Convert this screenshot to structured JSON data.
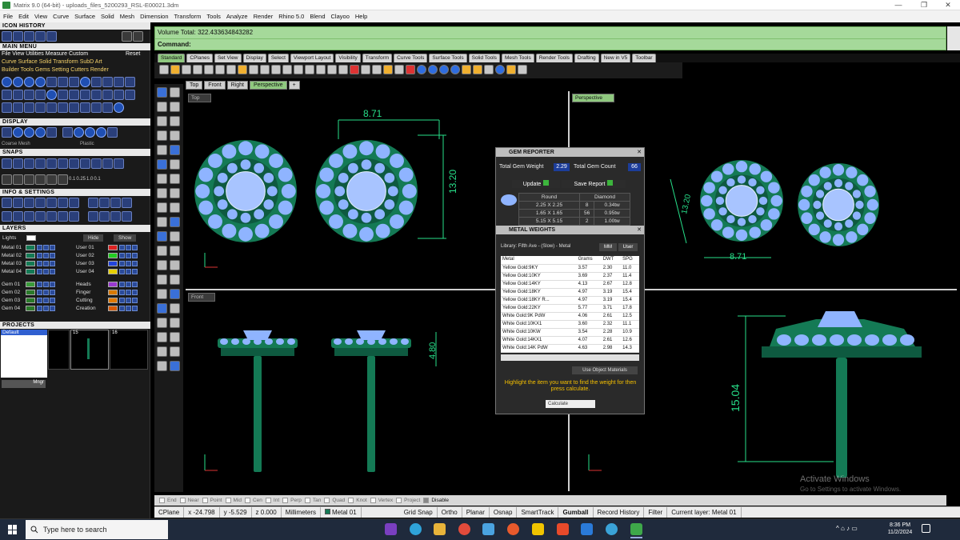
{
  "window": {
    "title": "Matrix 9.0 (64-bit) - uploads_files_5200293_RSL-E00021.3dm",
    "min": "—",
    "max": "❐",
    "close": "✕"
  },
  "menu": [
    "File",
    "Edit",
    "View",
    "Curve",
    "Surface",
    "Solid",
    "Mesh",
    "Dimension",
    "Transform",
    "Tools",
    "Analyze",
    "Render",
    "Rhino 5.0",
    "Blend",
    "Clayoo",
    "Help"
  ],
  "left": {
    "icon_history": "ICON HISTORY",
    "main_menu": "MAIN MENU",
    "main_menu_row1": [
      "File",
      "View",
      "Utilities",
      "Measure",
      "Custom"
    ],
    "main_menu_reset": "Reset",
    "main_menu_row2": [
      "Curve",
      "Surface",
      "Solid",
      "Transform",
      "SubD",
      "Art"
    ],
    "main_menu_row3": [
      "Builder",
      "Tools",
      "Gems",
      "Setting",
      "Cutters",
      "Render"
    ],
    "display": "DISPLAY",
    "display_modes": [
      "Coarse Mesh",
      "Plastic"
    ],
    "snaps": "SNAPS",
    "snap_values": [
      "0.1",
      "0.25",
      "1.0",
      "0.1"
    ],
    "info_settings": "INFO & SETTINGS",
    "layers": "LAYERS",
    "layers_lights": "Lights",
    "layers_hide": "Hide",
    "layers_show": "Show",
    "layer_col1": [
      "Metal 01",
      "Metal 02",
      "Metal 03",
      "Metal 04",
      "",
      "Gem 01",
      "Gem 02",
      "Gem 03",
      "Gem 04"
    ],
    "layer_col2": [
      "User 01",
      "User 02",
      "User 03",
      "User 04",
      "",
      "Heads",
      "Finger",
      "Cutting",
      "Creation"
    ],
    "projects": "PROJECTS",
    "project_default": "Default",
    "project_nums": [
      "15",
      "16"
    ],
    "mngr": "Mngr"
  },
  "command": {
    "history": "Volume Total: 322.433634843282",
    "prompt": "Command:"
  },
  "toolbar_tabs": [
    "Standard",
    "CPlanes",
    "Set View",
    "Display",
    "Select",
    "Viewport Layout",
    "Visibility",
    "Transform",
    "Curve Tools",
    "Surface Tools",
    "Solid Tools",
    "Mesh Tools",
    "Render Tools",
    "Drafting",
    "New in V5",
    "Toolbar"
  ],
  "view_tabs": [
    "Top",
    "Front",
    "Right",
    "Perspective"
  ],
  "viewports": {
    "top": "Top",
    "perspective": "Perspective",
    "front": "Front"
  },
  "dims": {
    "top_width": "8.71",
    "top_height": "13.20",
    "persp_width": "8.71",
    "persp_height": "13.20",
    "front_height": "4.80",
    "persp_front_height": "15.04"
  },
  "gem_reporter": {
    "title": "GEM REPORTER",
    "total_weight_label": "Total Gem Weight",
    "total_weight": "2.29",
    "total_count_label": "Total Gem Count",
    "total_count": "66",
    "update": "Update",
    "save_report": "Save Report",
    "headers": [
      "Round",
      "Diamond"
    ],
    "rows": [
      {
        "size": "2.25 X 2.25",
        "count": "8",
        "ct": "0.34tw"
      },
      {
        "size": "1.65 X 1.65",
        "count": "56",
        "ct": "0.95tw"
      },
      {
        "size": "5.15 X 5.15",
        "count": "2",
        "ct": "1.00tw"
      }
    ]
  },
  "metal_weights": {
    "title": "METAL WEIGHTS",
    "library": "Library: Fifth Ave - (Slow) - Metal",
    "mm": "MM",
    "user": "User",
    "headers": [
      "Metal",
      "Grams",
      "DWT",
      "SPG"
    ],
    "rows": [
      [
        "Yellow Gold:9KY",
        "3.57",
        "2.30",
        "11.0"
      ],
      [
        "Yellow Gold:10KY",
        "3.69",
        "2.37",
        "11.4"
      ],
      [
        "Yellow Gold:14KY",
        "4.13",
        "2.67",
        "12.8"
      ],
      [
        "Yellow Gold:18KY",
        "4.97",
        "3.19",
        "15.4"
      ],
      [
        "Yellow Gold:18KY R...",
        "4.97",
        "3.19",
        "15.4"
      ],
      [
        "Yellow Gold:22KY",
        "5.77",
        "3.71",
        "17.8"
      ],
      [
        "White Gold:9K PdW",
        "4.06",
        "2.61",
        "12.5"
      ],
      [
        "White Gold:10KX1",
        "3.60",
        "2.32",
        "11.1"
      ],
      [
        "White Gold:10KW",
        "3.54",
        "2.28",
        "10.9"
      ],
      [
        "White Gold:14KX1",
        "4.07",
        "2.61",
        "12.6"
      ],
      [
        "White Gold:14K PdW",
        "4.63",
        "2.98",
        "14.3"
      ]
    ],
    "use_object": "Use Object Materials",
    "hint": "Highlight the item you want to find the weight for then press calculate.",
    "calculate": "Calculate"
  },
  "osnap": [
    "End",
    "Near",
    "Point",
    "Mid",
    "Cen",
    "Int",
    "Perp",
    "Tan",
    "Quad",
    "Knot",
    "Vertex",
    "Project",
    "Disable"
  ],
  "status": {
    "cplane": "CPlane",
    "x": "x -24.798",
    "y": "y -5.529",
    "z": "z 0.000",
    "units": "Millimeters",
    "layer": "Metal 01",
    "grid_snap": "Grid Snap",
    "ortho": "Ortho",
    "planar": "Planar",
    "osnap": "Osnap",
    "smarttrack": "SmartTrack",
    "gumball": "Gumball",
    "record": "Record History",
    "filter": "Filter",
    "current_layer": "Current layer: Metal 01"
  },
  "watermark": {
    "line1": "Activate Windows",
    "line2": "Go to Settings to activate Windows."
  },
  "taskbar": {
    "search": "Type here to search",
    "time": "8:36 PM",
    "date": "11/2/2024"
  },
  "colors": {
    "metal": "#147a55",
    "gem": "#8fb4ff",
    "accent": "#8fc87f",
    "dimension": "#27e08a"
  }
}
